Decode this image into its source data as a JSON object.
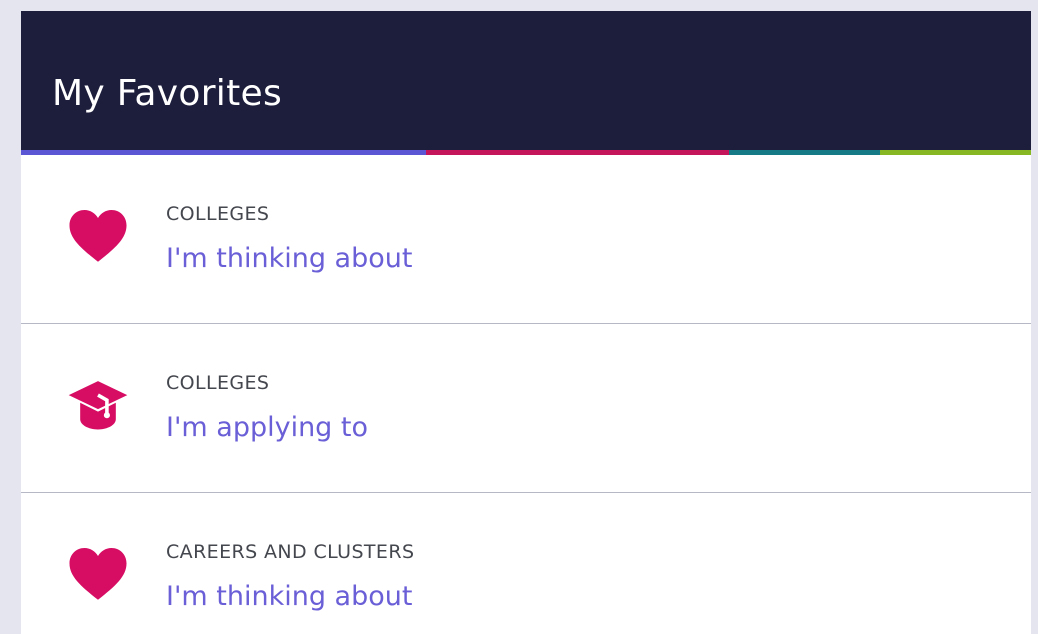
{
  "panel": {
    "title": "My Favorites"
  },
  "colors": {
    "header_bg": "#1c1e3c",
    "accent_pink": "#d60d63",
    "link_purple": "#6a5fd6",
    "stripe": [
      "#5a56d4",
      "#c4145a",
      "#167a86",
      "#87b723"
    ]
  },
  "items": [
    {
      "icon": "heart-icon",
      "category": "COLLEGES",
      "label": "I'm thinking about"
    },
    {
      "icon": "graduation-cap-icon",
      "category": "COLLEGES",
      "label": "I'm applying to"
    },
    {
      "icon": "heart-icon",
      "category": "CAREERS AND CLUSTERS",
      "label": "I'm thinking about"
    }
  ]
}
